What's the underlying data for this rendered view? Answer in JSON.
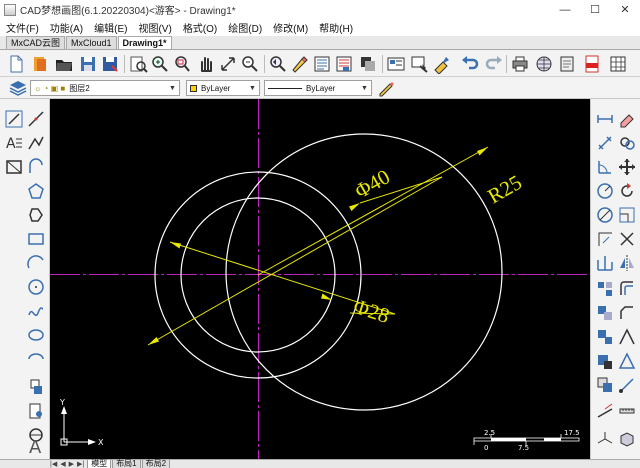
{
  "window": {
    "title": "CAD梦想画图(6.1.20220304)<游客> - Drawing1*",
    "controls": {
      "minimize": "—",
      "maximize": "☐",
      "close": "✕"
    }
  },
  "menu": [
    "文件(F)",
    "功能(A)",
    "编辑(E)",
    "视图(V)",
    "格式(O)",
    "绘图(D)",
    "修改(M)",
    "帮助(H)"
  ],
  "doc_tabs": [
    {
      "label": "MxCAD云图",
      "active": false
    },
    {
      "label": "MxCloud1",
      "active": false
    },
    {
      "label": "Drawing1*",
      "active": true
    }
  ],
  "properties_bar": {
    "layer": "图层2",
    "color": "ByLayer",
    "linetype": "ByLayer"
  },
  "drawing": {
    "dims": {
      "big_dia": "Φ40",
      "small_dia": "Φ28",
      "radius": "R25"
    },
    "ucs": {
      "x_label": "X",
      "y_label": "Y"
    },
    "scale_bar": {
      "top": [
        "2.5",
        "17.5"
      ],
      "bottom": [
        "0",
        "7.5"
      ]
    }
  },
  "layout_tabs": {
    "nav": [
      "|◀",
      "◀",
      "▶",
      "▶|"
    ],
    "tabs": [
      {
        "label": "模型",
        "active": true
      },
      {
        "label": "布局1",
        "active": false
      },
      {
        "label": "布局2",
        "active": false
      }
    ]
  },
  "colors": {
    "canvas": "#000000",
    "dimension": "#ffff00",
    "geometry": "#ffffff",
    "centerline": "#ff00ff"
  },
  "icons": {
    "toolbar": [
      "new-icon",
      "open-icon",
      "open-folder-icon",
      "save-icon",
      "save-as-icon",
      "print-preview-icon",
      "zoom-realtime-icon",
      "zoom-window-icon",
      "pan-hand-icon",
      "zoom-extents-icon",
      "zoom-previous-icon",
      "zoom-in-icon",
      "zoom-out-icon",
      "undo-zoom-icon",
      "properties-icon",
      "match-properties-icon",
      "layer-manager-icon",
      "block-icon",
      "image-icon",
      "design-center-icon",
      "format-painter-icon",
      "undo-icon",
      "redo-icon",
      "plot-icon",
      "web-icon",
      "publish-icon",
      "pdf-icon",
      "grid-icon"
    ],
    "left": [
      "line-icon",
      "construction-line-icon",
      "polyline-icon",
      "mtext-icon",
      "rectangle-icon",
      "polygon-icon",
      "arc-icon",
      "circle-icon",
      "spline-icon",
      "ellipse-icon",
      "hatch-icon",
      "revcloud-icon",
      "insert-block-icon",
      "point-icon",
      "text-icon"
    ],
    "right": [
      "dim-linear-icon",
      "erase-icon",
      "copy-icon",
      "move-icon",
      "rotate-icon",
      "scale-icon",
      "trim-icon",
      "extend-icon",
      "offset-icon",
      "mirror-icon",
      "array-icon",
      "fillet-icon",
      "chamfer-icon",
      "explode-icon",
      "stretch-icon",
      "break-icon",
      "join-icon",
      "lengthen-icon",
      "draworder-icon",
      "align-icon",
      "measure-icon",
      "divide-icon"
    ]
  }
}
